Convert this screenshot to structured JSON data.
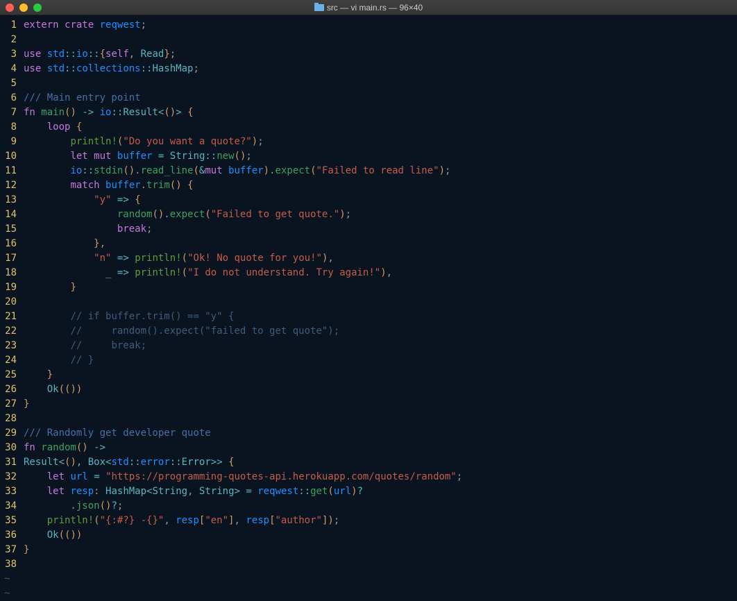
{
  "window": {
    "title": "src — vi main.rs — 96×40"
  },
  "code": {
    "lines": [
      [
        {
          "c": "kw",
          "t": "extern"
        },
        {
          "c": "pun",
          "t": " "
        },
        {
          "c": "kw",
          "t": "crate"
        },
        {
          "c": "pun",
          "t": " "
        },
        {
          "c": "id",
          "t": "reqwest"
        },
        {
          "c": "pun",
          "t": ";"
        }
      ],
      [],
      [
        {
          "c": "kw",
          "t": "use"
        },
        {
          "c": "pun",
          "t": " "
        },
        {
          "c": "id",
          "t": "std"
        },
        {
          "c": "op",
          "t": "::"
        },
        {
          "c": "id",
          "t": "io"
        },
        {
          "c": "op",
          "t": "::"
        },
        {
          "c": "brk",
          "t": "{"
        },
        {
          "c": "kw",
          "t": "self"
        },
        {
          "c": "pun",
          "t": ", "
        },
        {
          "c": "ty",
          "t": "Read"
        },
        {
          "c": "brk",
          "t": "}"
        },
        {
          "c": "pun",
          "t": ";"
        }
      ],
      [
        {
          "c": "kw",
          "t": "use"
        },
        {
          "c": "pun",
          "t": " "
        },
        {
          "c": "id",
          "t": "std"
        },
        {
          "c": "op",
          "t": "::"
        },
        {
          "c": "id",
          "t": "collections"
        },
        {
          "c": "op",
          "t": "::"
        },
        {
          "c": "ty",
          "t": "HashMap"
        },
        {
          "c": "pun",
          "t": ";"
        }
      ],
      [],
      [
        {
          "c": "doc",
          "t": "/// Main entry point"
        }
      ],
      [
        {
          "c": "kw",
          "t": "fn"
        },
        {
          "c": "pun",
          "t": " "
        },
        {
          "c": "fn",
          "t": "main"
        },
        {
          "c": "brk",
          "t": "()"
        },
        {
          "c": "pun",
          "t": " "
        },
        {
          "c": "op",
          "t": "->"
        },
        {
          "c": "pun",
          "t": " "
        },
        {
          "c": "id",
          "t": "io"
        },
        {
          "c": "op",
          "t": "::"
        },
        {
          "c": "ty",
          "t": "Result"
        },
        {
          "c": "op",
          "t": "<"
        },
        {
          "c": "brk",
          "t": "()"
        },
        {
          "c": "op",
          "t": ">"
        },
        {
          "c": "pun",
          "t": " "
        },
        {
          "c": "brk",
          "t": "{"
        }
      ],
      [
        {
          "c": "pun",
          "t": "    "
        },
        {
          "c": "kw",
          "t": "loop"
        },
        {
          "c": "pun",
          "t": " "
        },
        {
          "c": "brk",
          "t": "{"
        }
      ],
      [
        {
          "c": "pun",
          "t": "        "
        },
        {
          "c": "mac",
          "t": "println!"
        },
        {
          "c": "brk",
          "t": "("
        },
        {
          "c": "str",
          "t": "\"Do you want a quote?\""
        },
        {
          "c": "brk",
          "t": ")"
        },
        {
          "c": "pun",
          "t": ";"
        }
      ],
      [
        {
          "c": "pun",
          "t": "        "
        },
        {
          "c": "kw",
          "t": "let"
        },
        {
          "c": "pun",
          "t": " "
        },
        {
          "c": "kw",
          "t": "mut"
        },
        {
          "c": "pun",
          "t": " "
        },
        {
          "c": "id",
          "t": "buffer"
        },
        {
          "c": "pun",
          "t": " "
        },
        {
          "c": "op",
          "t": "="
        },
        {
          "c": "pun",
          "t": " "
        },
        {
          "c": "ty",
          "t": "String"
        },
        {
          "c": "op",
          "t": "::"
        },
        {
          "c": "fn",
          "t": "new"
        },
        {
          "c": "brk",
          "t": "()"
        },
        {
          "c": "pun",
          "t": ";"
        }
      ],
      [
        {
          "c": "pun",
          "t": "        "
        },
        {
          "c": "id",
          "t": "io"
        },
        {
          "c": "op",
          "t": "::"
        },
        {
          "c": "fn",
          "t": "stdin"
        },
        {
          "c": "brk",
          "t": "()"
        },
        {
          "c": "pun",
          "t": "."
        },
        {
          "c": "fn",
          "t": "read_line"
        },
        {
          "c": "brk",
          "t": "("
        },
        {
          "c": "op",
          "t": "&"
        },
        {
          "c": "kw",
          "t": "mut"
        },
        {
          "c": "pun",
          "t": " "
        },
        {
          "c": "id",
          "t": "buffer"
        },
        {
          "c": "brk",
          "t": ")"
        },
        {
          "c": "pun",
          "t": "."
        },
        {
          "c": "fn",
          "t": "expect"
        },
        {
          "c": "brk",
          "t": "("
        },
        {
          "c": "str",
          "t": "\"Failed to read line\""
        },
        {
          "c": "brk",
          "t": ")"
        },
        {
          "c": "pun",
          "t": ";"
        }
      ],
      [
        {
          "c": "pun",
          "t": "        "
        },
        {
          "c": "kw",
          "t": "match"
        },
        {
          "c": "pun",
          "t": " "
        },
        {
          "c": "id",
          "t": "buffer"
        },
        {
          "c": "pun",
          "t": "."
        },
        {
          "c": "fn",
          "t": "trim"
        },
        {
          "c": "brk",
          "t": "()"
        },
        {
          "c": "pun",
          "t": " "
        },
        {
          "c": "brk",
          "t": "{"
        }
      ],
      [
        {
          "c": "pun",
          "t": "            "
        },
        {
          "c": "str",
          "t": "\"y\""
        },
        {
          "c": "pun",
          "t": " "
        },
        {
          "c": "op",
          "t": "=>"
        },
        {
          "c": "pun",
          "t": " "
        },
        {
          "c": "brk",
          "t": "{"
        }
      ],
      [
        {
          "c": "pun",
          "t": "                "
        },
        {
          "c": "fn",
          "t": "random"
        },
        {
          "c": "brk",
          "t": "()"
        },
        {
          "c": "pun",
          "t": "."
        },
        {
          "c": "fn",
          "t": "expect"
        },
        {
          "c": "brk",
          "t": "("
        },
        {
          "c": "str",
          "t": "\"Failed to get quote.\""
        },
        {
          "c": "brk",
          "t": ")"
        },
        {
          "c": "pun",
          "t": ";"
        }
      ],
      [
        {
          "c": "pun",
          "t": "                "
        },
        {
          "c": "kw",
          "t": "break"
        },
        {
          "c": "pun",
          "t": ";"
        }
      ],
      [
        {
          "c": "pun",
          "t": "            "
        },
        {
          "c": "brk",
          "t": "}"
        },
        {
          "c": "pun",
          "t": ","
        }
      ],
      [
        {
          "c": "pun",
          "t": "            "
        },
        {
          "c": "str",
          "t": "\"n\""
        },
        {
          "c": "pun",
          "t": " "
        },
        {
          "c": "op",
          "t": "=>"
        },
        {
          "c": "pun",
          "t": " "
        },
        {
          "c": "mac",
          "t": "println!"
        },
        {
          "c": "brk",
          "t": "("
        },
        {
          "c": "str",
          "t": "\"Ok! No quote for you!\""
        },
        {
          "c": "brk",
          "t": ")"
        },
        {
          "c": "pun",
          "t": ","
        }
      ],
      [
        {
          "c": "pun",
          "t": "              "
        },
        {
          "c": "var",
          "t": "_"
        },
        {
          "c": "pun",
          "t": " "
        },
        {
          "c": "op",
          "t": "=>"
        },
        {
          "c": "pun",
          "t": " "
        },
        {
          "c": "mac",
          "t": "println!"
        },
        {
          "c": "brk",
          "t": "("
        },
        {
          "c": "str",
          "t": "\"I do not understand. Try again!\""
        },
        {
          "c": "brk",
          "t": ")"
        },
        {
          "c": "pun",
          "t": ","
        }
      ],
      [
        {
          "c": "pun",
          "t": "        "
        },
        {
          "c": "brk",
          "t": "}"
        }
      ],
      [],
      [
        {
          "c": "pun",
          "t": "        "
        },
        {
          "c": "cmt",
          "t": "// if buffer.trim() == \"y\" {"
        }
      ],
      [
        {
          "c": "pun",
          "t": "        "
        },
        {
          "c": "cmt",
          "t": "//     random().expect(\"failed to get quote\");"
        }
      ],
      [
        {
          "c": "pun",
          "t": "        "
        },
        {
          "c": "cmt",
          "t": "//     break;"
        }
      ],
      [
        {
          "c": "pun",
          "t": "        "
        },
        {
          "c": "cmt",
          "t": "// }"
        }
      ],
      [
        {
          "c": "pun",
          "t": "    "
        },
        {
          "c": "brk",
          "t": "}"
        }
      ],
      [
        {
          "c": "pun",
          "t": "    "
        },
        {
          "c": "ty",
          "t": "Ok"
        },
        {
          "c": "brk",
          "t": "("
        },
        {
          "c": "brk",
          "t": "()"
        },
        {
          "c": "brk",
          "t": ")"
        }
      ],
      [
        {
          "c": "brk",
          "t": "}"
        }
      ],
      [],
      [
        {
          "c": "doc",
          "t": "/// Randomly get developer quote"
        }
      ],
      [
        {
          "c": "kw",
          "t": "fn"
        },
        {
          "c": "pun",
          "t": " "
        },
        {
          "c": "fn",
          "t": "random"
        },
        {
          "c": "brk",
          "t": "()"
        },
        {
          "c": "pun",
          "t": " "
        },
        {
          "c": "op",
          "t": "->"
        }
      ],
      [
        {
          "c": "ty",
          "t": "Result"
        },
        {
          "c": "op",
          "t": "<"
        },
        {
          "c": "brk",
          "t": "()"
        },
        {
          "c": "pun",
          "t": ", "
        },
        {
          "c": "ty",
          "t": "Box"
        },
        {
          "c": "op",
          "t": "<"
        },
        {
          "c": "id",
          "t": "std"
        },
        {
          "c": "op",
          "t": "::"
        },
        {
          "c": "id",
          "t": "error"
        },
        {
          "c": "op",
          "t": "::"
        },
        {
          "c": "ty",
          "t": "Error"
        },
        {
          "c": "op",
          "t": ">>"
        },
        {
          "c": "pun",
          "t": " "
        },
        {
          "c": "brk",
          "t": "{"
        }
      ],
      [
        {
          "c": "pun",
          "t": "    "
        },
        {
          "c": "kw",
          "t": "let"
        },
        {
          "c": "pun",
          "t": " "
        },
        {
          "c": "id",
          "t": "url"
        },
        {
          "c": "pun",
          "t": " "
        },
        {
          "c": "op",
          "t": "="
        },
        {
          "c": "pun",
          "t": " "
        },
        {
          "c": "str",
          "t": "\"https://programming-quotes-api.herokuapp.com/quotes/random\""
        },
        {
          "c": "pun",
          "t": ";"
        }
      ],
      [
        {
          "c": "pun",
          "t": "    "
        },
        {
          "c": "kw",
          "t": "let"
        },
        {
          "c": "pun",
          "t": " "
        },
        {
          "c": "id",
          "t": "resp"
        },
        {
          "c": "pun",
          "t": ": "
        },
        {
          "c": "ty",
          "t": "HashMap"
        },
        {
          "c": "op",
          "t": "<"
        },
        {
          "c": "ty",
          "t": "String"
        },
        {
          "c": "pun",
          "t": ", "
        },
        {
          "c": "ty",
          "t": "String"
        },
        {
          "c": "op",
          "t": ">"
        },
        {
          "c": "pun",
          "t": " "
        },
        {
          "c": "op",
          "t": "="
        },
        {
          "c": "pun",
          "t": " "
        },
        {
          "c": "id",
          "t": "reqwest"
        },
        {
          "c": "op",
          "t": "::"
        },
        {
          "c": "fn",
          "t": "get"
        },
        {
          "c": "brk",
          "t": "("
        },
        {
          "c": "id",
          "t": "url"
        },
        {
          "c": "brk",
          "t": ")"
        },
        {
          "c": "op",
          "t": "?"
        }
      ],
      [
        {
          "c": "pun",
          "t": "        ."
        },
        {
          "c": "fn",
          "t": "json"
        },
        {
          "c": "brk",
          "t": "()"
        },
        {
          "c": "op",
          "t": "?"
        },
        {
          "c": "pun",
          "t": ";"
        }
      ],
      [
        {
          "c": "pun",
          "t": "    "
        },
        {
          "c": "mac",
          "t": "println!"
        },
        {
          "c": "brk",
          "t": "("
        },
        {
          "c": "str",
          "t": "\"{:#?} -{}\""
        },
        {
          "c": "pun",
          "t": ", "
        },
        {
          "c": "id",
          "t": "resp"
        },
        {
          "c": "brk",
          "t": "["
        },
        {
          "c": "str",
          "t": "\"en\""
        },
        {
          "c": "brk",
          "t": "]"
        },
        {
          "c": "pun",
          "t": ", "
        },
        {
          "c": "id",
          "t": "resp"
        },
        {
          "c": "brk",
          "t": "["
        },
        {
          "c": "str",
          "t": "\"author\""
        },
        {
          "c": "brk",
          "t": "]"
        },
        {
          "c": "brk",
          "t": ")"
        },
        {
          "c": "pun",
          "t": ";"
        }
      ],
      [
        {
          "c": "pun",
          "t": "    "
        },
        {
          "c": "ty",
          "t": "Ok"
        },
        {
          "c": "brk",
          "t": "("
        },
        {
          "c": "brk",
          "t": "()"
        },
        {
          "c": "brk",
          "t": ")"
        }
      ],
      [
        {
          "c": "brk",
          "t": "}"
        }
      ],
      []
    ]
  }
}
